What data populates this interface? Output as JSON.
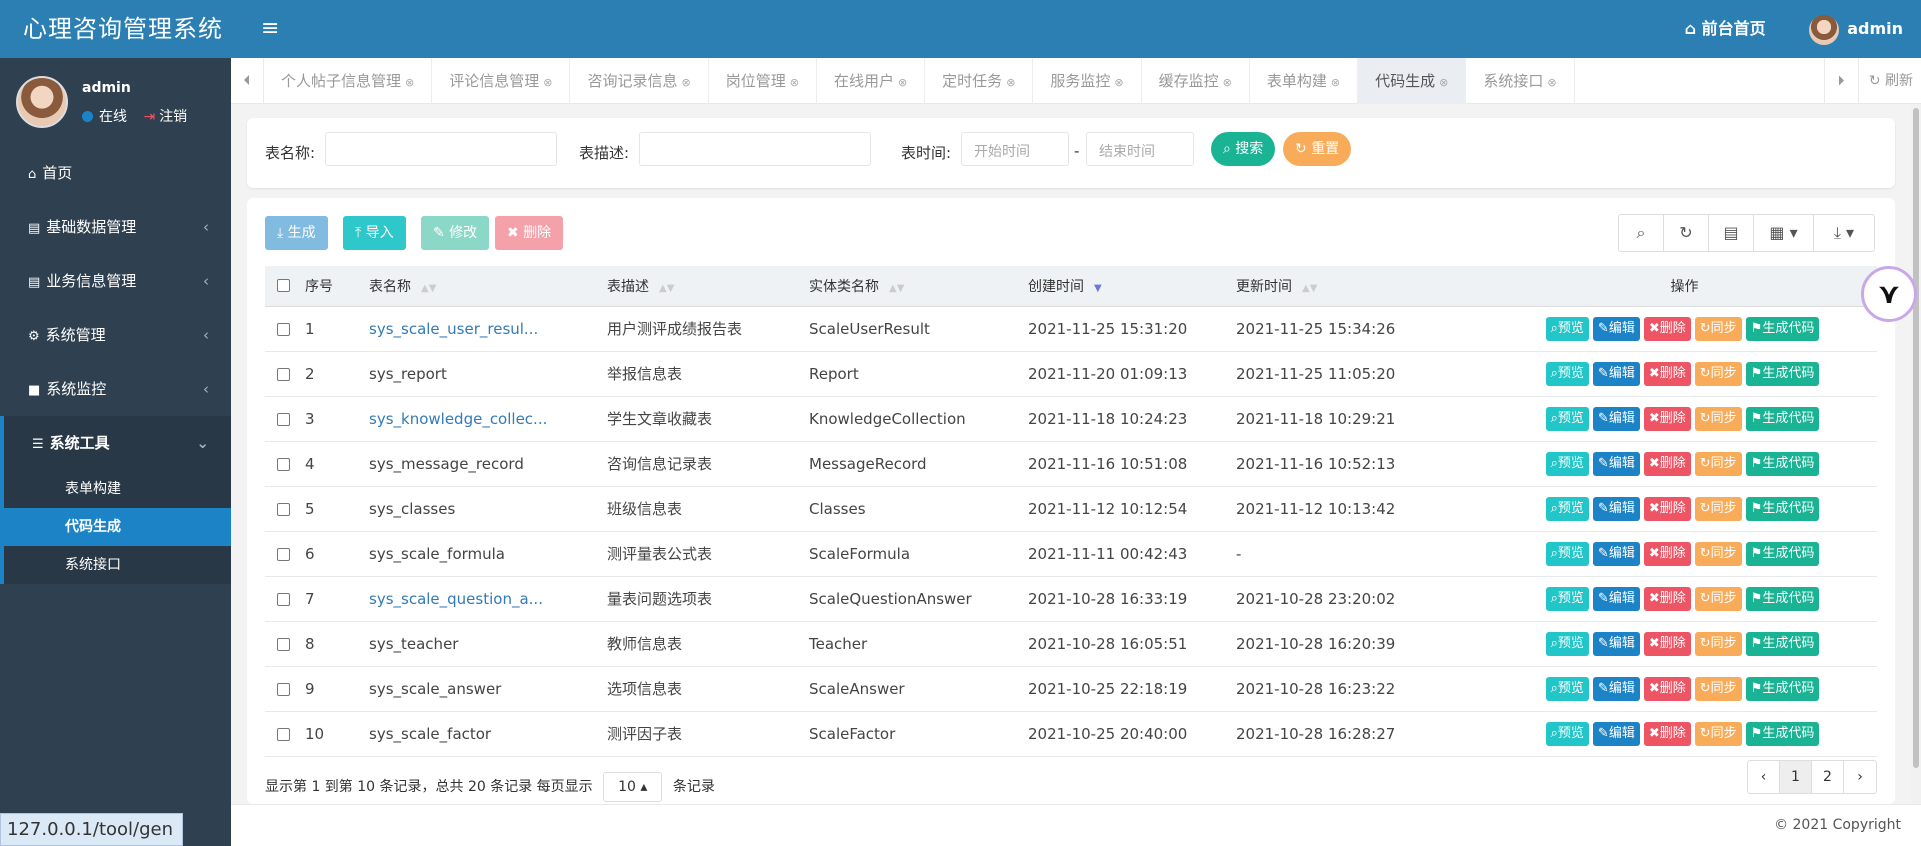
{
  "app": {
    "title": "心理咨询管理系统"
  },
  "user": {
    "name": "admin",
    "status": "在线",
    "logout": "注销"
  },
  "sidebar": {
    "items": [
      {
        "label": "首页",
        "icon": "home-icon"
      },
      {
        "label": "基础数据管理",
        "icon": "table-icon"
      },
      {
        "label": "业务信息管理",
        "icon": "table-icon"
      },
      {
        "label": "系统管理",
        "icon": "gear-icon"
      },
      {
        "label": "系统监控",
        "icon": "video-icon"
      },
      {
        "label": "系统工具",
        "icon": "bars-icon"
      }
    ],
    "subitems": [
      {
        "label": "表单构建"
      },
      {
        "label": "代码生成"
      },
      {
        "label": "系统接口"
      }
    ]
  },
  "topbar": {
    "home_label": "前台首页",
    "user": "admin"
  },
  "tabs": [
    "个人帖子信息管理",
    "评论信息管理",
    "咨询记录信息",
    "岗位管理",
    "在线用户",
    "定时任务",
    "服务监控",
    "缓存监控",
    "表单构建",
    "代码生成",
    "系统接口"
  ],
  "refresh_label": "刷新",
  "search": {
    "table_name_label": "表名称:",
    "table_desc_label": "表描述:",
    "time_label": "表时间:",
    "start_placeholder": "开始时间",
    "end_placeholder": "结束时间",
    "dash": "-",
    "search_btn": "搜索",
    "reset_btn": "重置"
  },
  "toolbar": {
    "generate": "生成",
    "import": "导入",
    "modify": "修改",
    "delete": "删除"
  },
  "table": {
    "headers": [
      "序号",
      "表名称",
      "表描述",
      "实体类名称",
      "创建时间",
      "更新时间",
      "操作"
    ],
    "rows": [
      [
        "1",
        "sys_scale_user_resul...",
        "用户测评成绩报告表",
        "ScaleUserResult",
        "2021-11-25 15:31:20",
        "2021-11-25 15:34:26"
      ],
      [
        "2",
        "sys_report",
        "举报信息表",
        "Report",
        "2021-11-20 01:09:13",
        "2021-11-25 11:05:20"
      ],
      [
        "3",
        "sys_knowledge_collec...",
        "学生文章收藏表",
        "KnowledgeCollection",
        "2021-11-18 10:24:23",
        "2021-11-18 10:29:21"
      ],
      [
        "4",
        "sys_message_record",
        "咨询信息记录表",
        "MessageRecord",
        "2021-11-16 10:51:08",
        "2021-11-16 10:52:13"
      ],
      [
        "5",
        "sys_classes",
        "班级信息表",
        "Classes",
        "2021-11-12 10:12:54",
        "2021-11-12 10:13:42"
      ],
      [
        "6",
        "sys_scale_formula",
        "测评量表公式表",
        "ScaleFormula",
        "2021-11-11 00:42:43",
        "-"
      ],
      [
        "7",
        "sys_scale_question_a...",
        "量表问题选项表",
        "ScaleQuestionAnswer",
        "2021-10-28 16:33:19",
        "2021-10-28 23:20:02"
      ],
      [
        "8",
        "sys_teacher",
        "教师信息表",
        "Teacher",
        "2021-10-28 16:05:51",
        "2021-10-28 16:20:39"
      ],
      [
        "9",
        "sys_scale_answer",
        "选项信息表",
        "ScaleAnswer",
        "2021-10-25 22:18:19",
        "2021-10-28 16:23:22"
      ],
      [
        "10",
        "sys_scale_factor",
        "测评因子表",
        "ScaleFactor",
        "2021-10-25 20:40:00",
        "2021-10-28 16:28:27"
      ]
    ],
    "linked_rows": [
      0,
      2,
      6
    ],
    "ops": [
      "预览",
      "编辑",
      "删除",
      "同步",
      "生成代码"
    ]
  },
  "pagination": {
    "info_prefix": "显示第 1 到第 10 条记录，总共 20 条记录  每页显示",
    "page_size": "10",
    "info_suffix": "条记录",
    "pages": [
      "‹",
      "1",
      "2",
      "›"
    ]
  },
  "footer": {
    "copyright": "© 2021 Copyright"
  },
  "statusbar": {
    "url": "127.0.0.1/tool/gen"
  }
}
